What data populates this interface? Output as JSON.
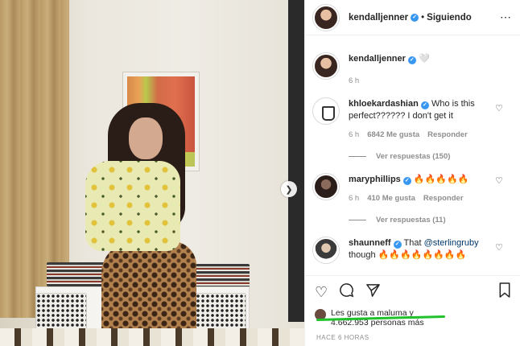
{
  "header": {
    "username": "kendalljenner",
    "separator": "•",
    "follow_status": "Siguiendo",
    "more": "⋯"
  },
  "caption": {
    "username": "kendalljenner",
    "text": "🤍",
    "time": "6 h"
  },
  "comments": [
    {
      "username": "khloekardashian",
      "text": "Who is this perfect?????? I don't get it",
      "time": "6 h",
      "likes": "6842 Me gusta",
      "reply": "Responder",
      "view_replies": "Ver respuestas (150)"
    },
    {
      "username": "maryphillips",
      "text": "🔥🔥🔥🔥🔥",
      "time": "6 h",
      "likes": "410 Me gusta",
      "reply": "Responder",
      "view_replies": "Ver respuestas (11)"
    },
    {
      "username": "shaunneff",
      "text_pre": "That ",
      "mention": "@sterlingruby",
      "text_post": " though 🔥🔥🔥🔥🔥🔥🔥🔥"
    }
  ],
  "footer": {
    "likes_line1": "Les gusta a maluma y",
    "likes_line2": "4.662.953 personas más",
    "posted": "HACE 6 HORAS"
  },
  "colors": {
    "verified": "#3897f0",
    "highlight": "#1fc22a",
    "text": "#262626",
    "muted": "#8e8e8e"
  },
  "icons": [
    "heart-icon",
    "comment-icon",
    "share-icon",
    "bookmark-icon",
    "next-arrow-icon",
    "more-options-icon",
    "verified-badge-icon"
  ]
}
